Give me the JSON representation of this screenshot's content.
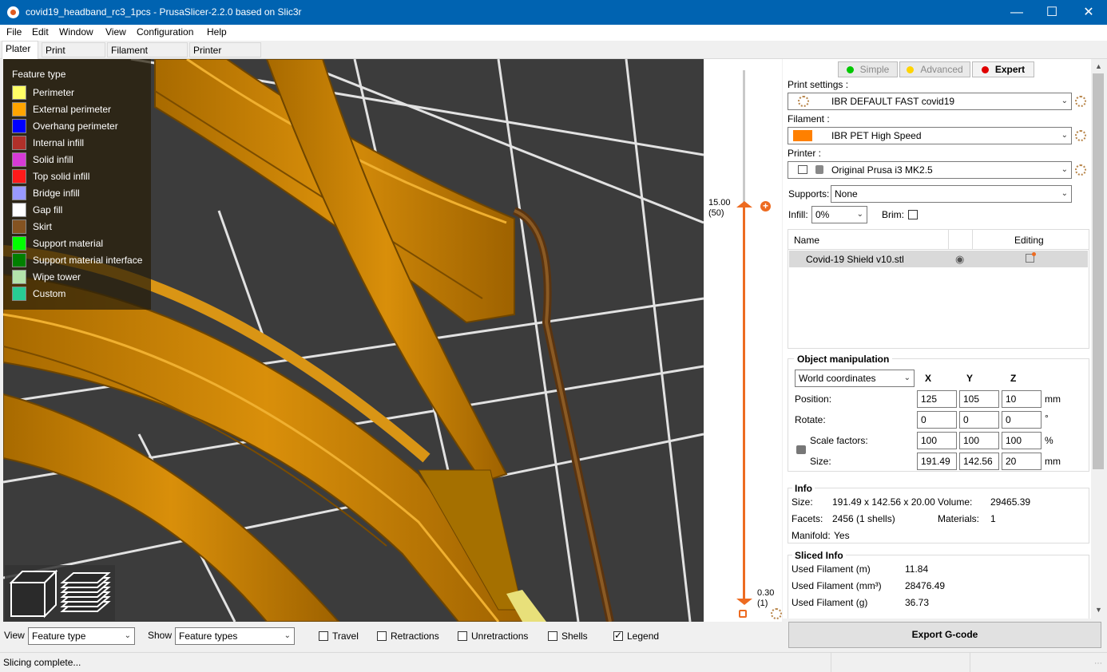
{
  "window": {
    "title": "covid19_headband_rc3_1pcs - PrusaSlicer-2.2.0 based on Slic3r"
  },
  "menu": [
    "File",
    "Edit",
    "Window",
    "View",
    "Configuration",
    "Help"
  ],
  "tabs": [
    "Plater",
    "Print Settings",
    "Filament Settings",
    "Printer Settings"
  ],
  "legend": {
    "title": "Feature type",
    "items": [
      {
        "label": "Perimeter",
        "color": "#ffff66"
      },
      {
        "label": "External perimeter",
        "color": "#ffa500"
      },
      {
        "label": "Overhang perimeter",
        "color": "#0000ff"
      },
      {
        "label": "Internal infill",
        "color": "#b03029"
      },
      {
        "label": "Solid infill",
        "color": "#d63ad6"
      },
      {
        "label": "Top solid infill",
        "color": "#ff1a1a"
      },
      {
        "label": "Bridge infill",
        "color": "#9999ff"
      },
      {
        "label": "Gap fill",
        "color": "#ffffff"
      },
      {
        "label": "Skirt",
        "color": "#845321"
      },
      {
        "label": "Support material",
        "color": "#00ff00"
      },
      {
        "label": "Support material interface",
        "color": "#008000"
      },
      {
        "label": "Wipe tower",
        "color": "#b3e3ab"
      },
      {
        "label": "Custom",
        "color": "#28cc94"
      }
    ]
  },
  "slider": {
    "top_value": "15.00",
    "top_layer": "(50)",
    "bottom_value": "0.30",
    "bottom_layer": "(1)"
  },
  "modes": {
    "simple": "Simple",
    "advanced": "Advanced",
    "expert": "Expert"
  },
  "settings": {
    "print_label": "Print settings :",
    "print_value": "IBR DEFAULT FAST covid19",
    "filament_label": "Filament :",
    "filament_value": "IBR PET High Speed",
    "filament_color": "#ff8000",
    "printer_label": "Printer :",
    "printer_value": "Original Prusa i3 MK2.5",
    "supports_label": "Supports:",
    "supports_value": "None",
    "infill_label": "Infill:",
    "infill_value": "0%",
    "brim_label": "Brim:"
  },
  "object_list": {
    "col_name": "Name",
    "col_editing": "Editing",
    "rows": [
      {
        "name": "Covid-19 Shield v10.stl"
      }
    ]
  },
  "manipulation": {
    "title": "Object manipulation",
    "coord_system": "World coordinates",
    "axes": [
      "X",
      "Y",
      "Z"
    ],
    "position_label": "Position:",
    "position": [
      "125",
      "105",
      "10"
    ],
    "position_unit": "mm",
    "rotate_label": "Rotate:",
    "rotate": [
      "0",
      "0",
      "0"
    ],
    "rotate_unit": "°",
    "scale_label": "Scale factors:",
    "scale": [
      "100",
      "100",
      "100"
    ],
    "scale_unit": "%",
    "size_label": "Size:",
    "size": [
      "191.49",
      "142.56",
      "20"
    ],
    "size_unit": "mm"
  },
  "info": {
    "title": "Info",
    "size_label": "Size:",
    "size_value": "191.49 x 142.56 x 20.00",
    "volume_label": "Volume:",
    "volume_value": "29465.39",
    "facets_label": "Facets:",
    "facets_value": "2456 (1 shells)",
    "materials_label": "Materials:",
    "materials_value": "1",
    "manifold_label": "Manifold:",
    "manifold_value": "Yes"
  },
  "sliced_info": {
    "title": "Sliced Info",
    "rows": [
      {
        "label": "Used Filament (m)",
        "value": "11.84"
      },
      {
        "label": "Used Filament (mm³)",
        "value": "28476.49"
      },
      {
        "label": "Used Filament (g)",
        "value": "36.73"
      }
    ]
  },
  "export_button": "Export G-code",
  "bottom": {
    "view_label": "View",
    "view_value": "Feature type",
    "show_label": "Show",
    "show_value": "Feature types",
    "checkboxes": [
      {
        "label": "Travel",
        "checked": false
      },
      {
        "label": "Retractions",
        "checked": false
      },
      {
        "label": "Unretractions",
        "checked": false
      },
      {
        "label": "Shells",
        "checked": false
      },
      {
        "label": "Legend",
        "checked": true
      }
    ]
  },
  "status": "Slicing complete..."
}
